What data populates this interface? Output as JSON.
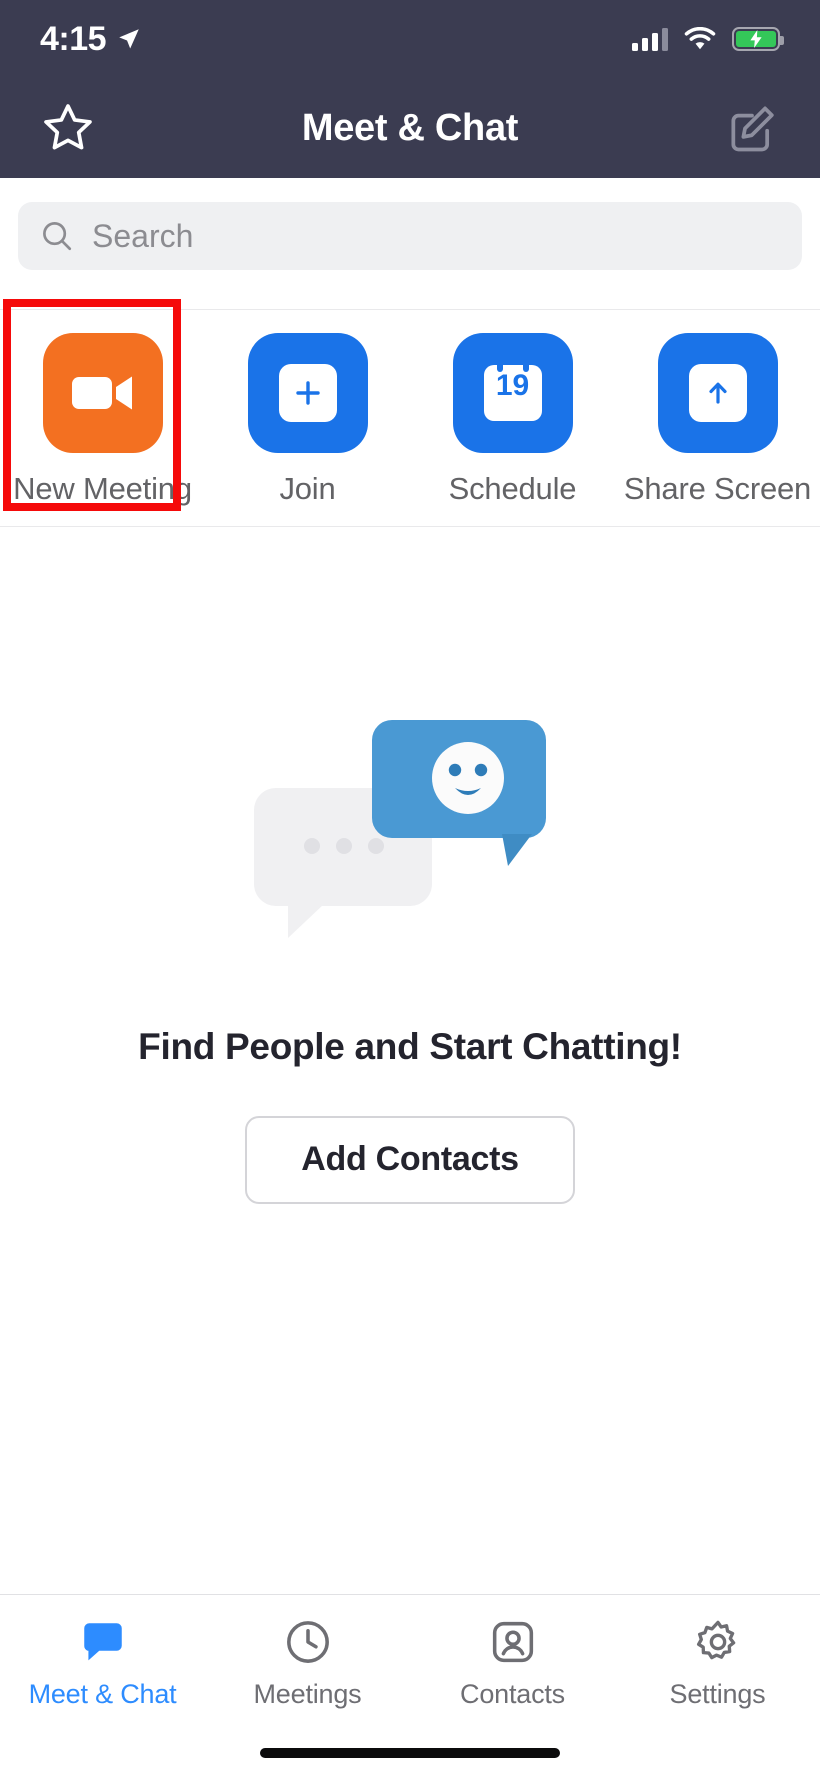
{
  "status_bar": {
    "time": "4:15",
    "location_icon": "location-arrow-icon",
    "signal_icon": "cellular-signal-icon",
    "signal_bars_filled": 3,
    "signal_bars_total": 4,
    "wifi_icon": "wifi-icon",
    "battery_icon": "battery-charging-icon",
    "battery_charging": true,
    "battery_color": "#34c759"
  },
  "nav": {
    "title": "Meet & Chat",
    "left_icon": "star-outline-icon",
    "right_icon": "compose-edit-icon",
    "background": "#3b3c51"
  },
  "search": {
    "placeholder": "Search",
    "icon": "search-icon"
  },
  "actions": [
    {
      "label": "New Meeting",
      "icon": "video-camera-icon",
      "color": "#f37021",
      "highlighted": true
    },
    {
      "label": "Join",
      "icon": "plus-icon",
      "color": "#1a73e8",
      "highlighted": false
    },
    {
      "label": "Schedule",
      "icon": "calendar-icon",
      "color": "#1a73e8",
      "highlighted": false,
      "calendar_day": "19"
    },
    {
      "label": "Share Screen",
      "icon": "arrow-up-icon",
      "color": "#1a73e8",
      "highlighted": false
    }
  ],
  "empty_state": {
    "illustration": "chat-bubbles-smiley-illustration",
    "title": "Find People and Start Chatting!",
    "button_label": "Add Contacts"
  },
  "tabs": [
    {
      "label": "Meet & Chat",
      "icon": "chat-bubble-icon",
      "active": true
    },
    {
      "label": "Meetings",
      "icon": "clock-icon",
      "active": false
    },
    {
      "label": "Contacts",
      "icon": "person-card-icon",
      "active": false
    },
    {
      "label": "Settings",
      "icon": "gear-icon",
      "active": false
    }
  ],
  "annotation": {
    "type": "highlight-box",
    "color": "#f50a0a",
    "target": "New Meeting"
  }
}
